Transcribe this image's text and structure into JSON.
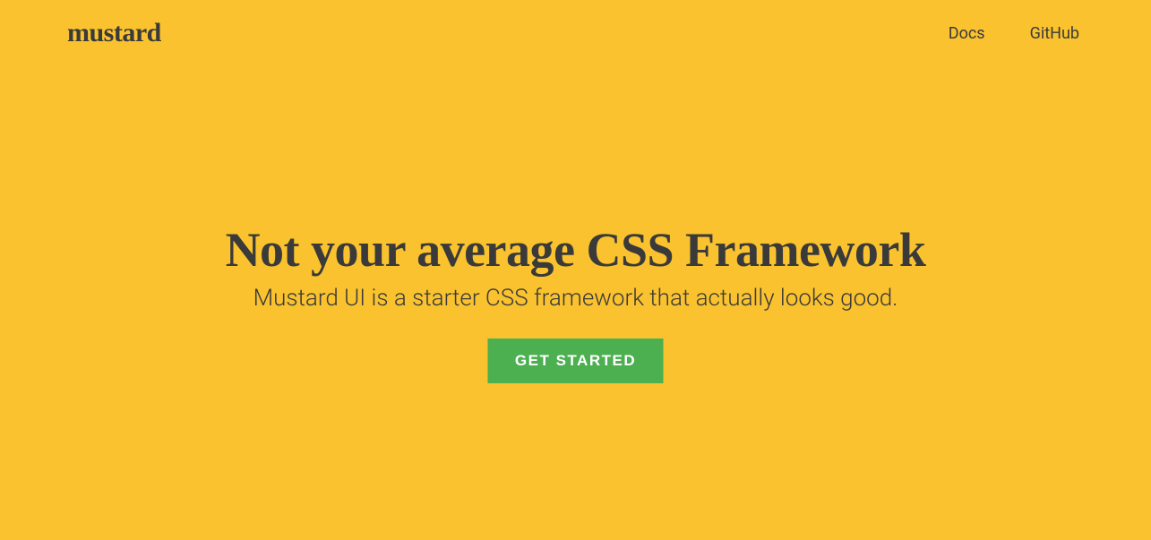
{
  "header": {
    "brand": "mustard",
    "nav": [
      {
        "label": "Docs"
      },
      {
        "label": "GitHub"
      }
    ]
  },
  "hero": {
    "title": "Not your average CSS Framework",
    "subtitle": "Mustard UI is a starter CSS framework that actually looks good.",
    "cta_label": "GET STARTED"
  },
  "colors": {
    "background": "#f9c22e",
    "text": "#3a3a3a",
    "button_bg": "#4caf50",
    "button_text": "#ffffff"
  }
}
